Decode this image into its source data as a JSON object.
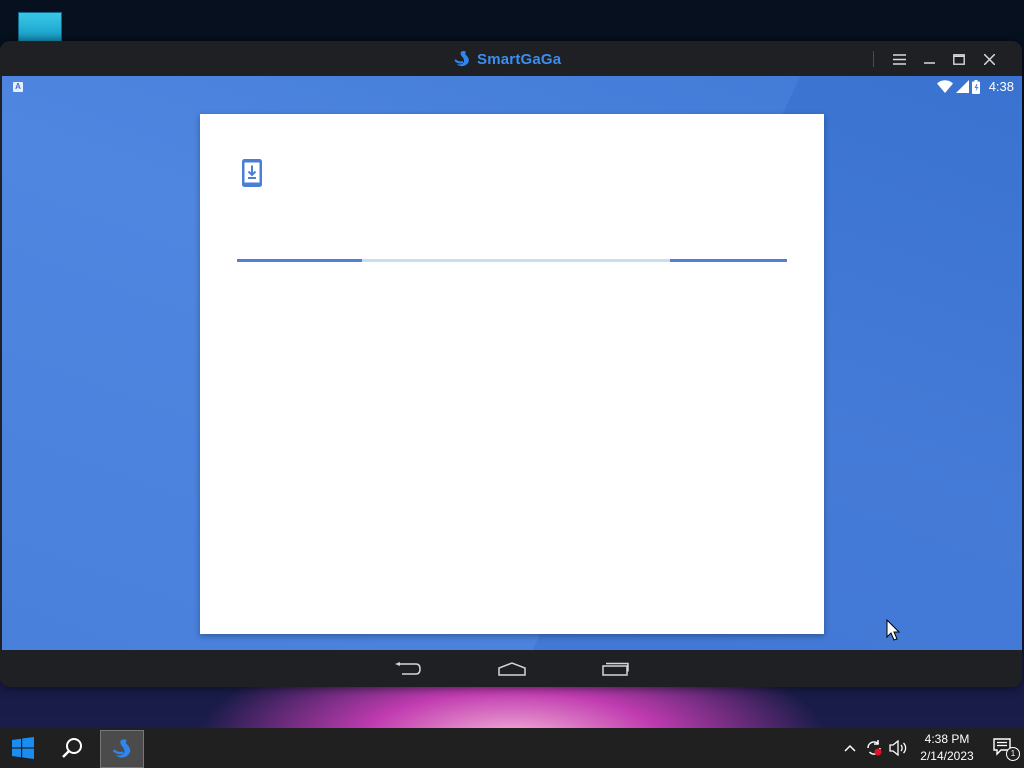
{
  "desktop": {
    "icon_name": "folder-icon"
  },
  "window": {
    "title": "SmartGaGa",
    "controls": [
      "menu-icon",
      "minimize-icon",
      "maximize-icon",
      "close-icon"
    ]
  },
  "android": {
    "status": {
      "badge": "A",
      "time": "4:38"
    },
    "dialog": {
      "icon": "download-phone-icon",
      "progress": 0.23
    },
    "nav": [
      "back-icon",
      "home-icon",
      "recents-icon"
    ]
  },
  "taskbar": {
    "time": "4:38 PM",
    "date": "2/14/2023",
    "notification_count": "1"
  },
  "colors": {
    "accent": "#3a8ef0",
    "android_bg": "#4a84dd",
    "progress": "#4f7fd6",
    "taskbar": "#202020"
  }
}
